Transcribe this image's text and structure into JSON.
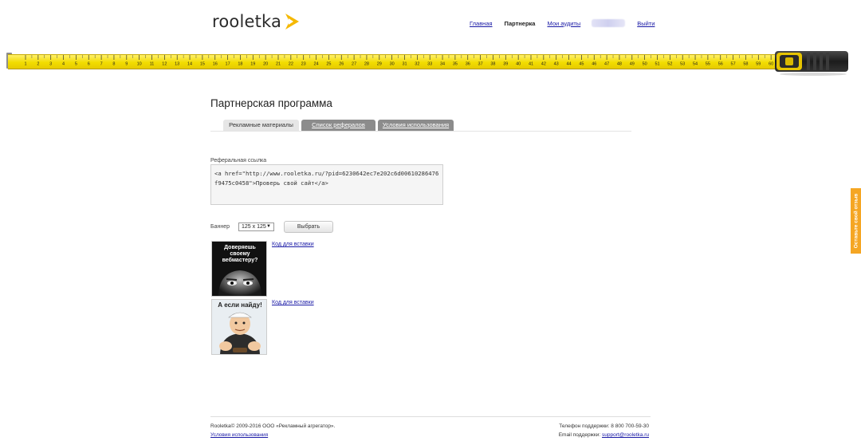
{
  "header": {
    "logo_text": "rooletka",
    "nav": {
      "home": "Главная",
      "partners": "Партнерка",
      "audits": "Мои аудиты",
      "logout": "Выйти"
    }
  },
  "tape": {
    "marks": [
      "1",
      "2",
      "3",
      "4",
      "5",
      "6",
      "7",
      "8",
      "9",
      "10",
      "11",
      "12",
      "13",
      "14",
      "15",
      "16",
      "17",
      "18",
      "19",
      "20",
      "21",
      "22",
      "23",
      "24",
      "25",
      "26",
      "27",
      "28",
      "29",
      "30",
      "31",
      "32",
      "33",
      "34",
      "35",
      "36",
      "37",
      "38",
      "39",
      "40",
      "41",
      "42",
      "43",
      "44",
      "45",
      "46",
      "47",
      "48",
      "49",
      "50",
      "51",
      "52",
      "53",
      "54",
      "55",
      "56",
      "57",
      "58",
      "59",
      "60"
    ]
  },
  "page": {
    "title": "Партнерская программа",
    "tabs": [
      "Рекламные материалы",
      "Список рефералов",
      "Условия использования"
    ]
  },
  "referral": {
    "label": "Реферальная ссылка",
    "code": "<a href=\"http://www.rooletka.ru/?pid=6230642ec7e202c6d00610286476f9475c0458\">Проверь свой сайт</a>"
  },
  "banner_controls": {
    "label": "Баннер",
    "size_selected": "125 x 125",
    "button": "Выбрать"
  },
  "banners": [
    {
      "text": "Доверяешь своему вебмастеру?",
      "link": "Код для вставки"
    },
    {
      "text": "А если найду!",
      "link": "Код для вставки"
    }
  ],
  "footer": {
    "copyright": "Rooletka© 2009-2016 ООО «Рекламный агрегатор».",
    "terms": "Условия использования",
    "phone": "Телефон поддержки: 8 800 700-59-30",
    "email_label": "Email поддержки: ",
    "email": "support@rooletka.ru"
  },
  "feedback_tab": "Оставьте свой отзыв",
  "colors": {
    "tape": "#f2dc00",
    "accent": "#f5a623",
    "link": "#1a1aa6"
  }
}
